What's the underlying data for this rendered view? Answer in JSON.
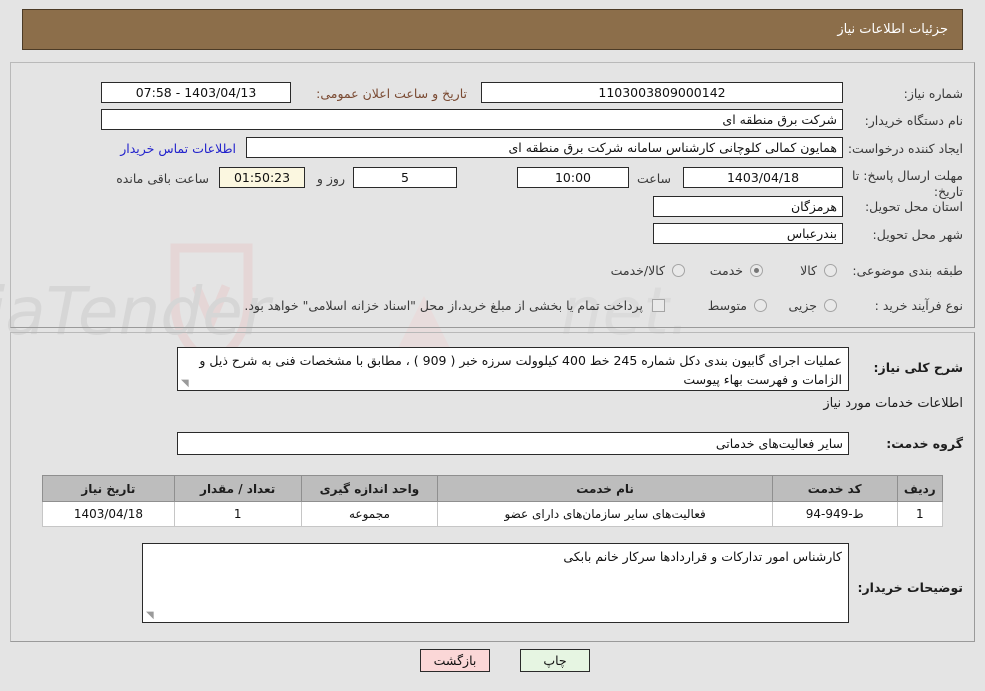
{
  "header": {
    "title": "جزئیات اطلاعات نیاز"
  },
  "top": {
    "need_number_label": "شماره نیاز:",
    "need_number_value": "1103003809000142",
    "public_announce_label": "تاریخ و ساعت اعلان عمومی:",
    "public_announce_value": "1403/04/13 - 07:58",
    "buyer_org_label": "نام دستگاه خریدار:",
    "buyer_org_value": "شرکت برق منطقه ای",
    "creator_label": "ایجاد کننده درخواست:",
    "creator_value": "همایون کمالی کلوچانی کارشناس سامانه شرکت برق منطقه ای",
    "contact_link": "اطلاعات تماس خریدار",
    "deadline_label": "مهلت ارسال پاسخ: تا تاریخ:",
    "deadline_date": "1403/04/18",
    "hour_label": "ساعت",
    "deadline_time": "10:00",
    "days_value": "5",
    "days_label": "روز و",
    "countdown_value": "01:50:23",
    "countdown_label": "ساعت باقی مانده",
    "province_label": "استان محل تحویل:",
    "province_value": "هرمزگان",
    "city_label": "شهر محل تحویل:",
    "city_value": "بندرعباس",
    "classification_label": "طبقه بندی موضوعی:",
    "classification_options": [
      {
        "label": "کالا",
        "selected": false
      },
      {
        "label": "خدمت",
        "selected": true
      },
      {
        "label": "کالا/خدمت",
        "selected": false
      }
    ],
    "process_label": "نوع فرآیند خرید :",
    "process_options": [
      {
        "label": "جزیی",
        "selected": false
      },
      {
        "label": "متوسط",
        "selected": false
      }
    ],
    "treasury_note": "پرداخت تمام یا بخشی از مبلغ خرید،از محل \"اسناد خزانه اسلامی\" خواهد بود."
  },
  "bottom": {
    "desc_label": "شرح کلی نیاز:",
    "desc_value": "عملیات اجرای گابیون بندی دکل شماره 245 خط 400 کیلوولت سرزه خبر ( 909 ) ، مطابق با مشخصات فنی به شرح ذیل و الزامات و فهرست بهاء پیوست",
    "services_heading": "اطلاعات خدمات مورد نیاز",
    "service_group_label": "گروه خدمت:",
    "service_group_value": "سایر فعالیت‌های خدماتی",
    "table": {
      "columns": [
        "ردیف",
        "کد خدمت",
        "نام خدمت",
        "واحد اندازه گیری",
        "تعداد / مقدار",
        "تاریخ نیاز"
      ],
      "rows": [
        {
          "row": "1",
          "code": "ط-949-94",
          "name": "فعالیت‌های سایر سازمان‌های دارای عضو",
          "unit": "مجموعه",
          "qty": "1",
          "date": "1403/04/18"
        }
      ]
    },
    "notes_label": "توضیحات خریدار:",
    "notes_value": "کارشناس امور تدارکات و قراردادها سرکار خانم بابکی"
  },
  "footer": {
    "print_label": "چاپ",
    "back_label": "بازگشت"
  },
  "watermark": {
    "text": "AriaTender.net"
  },
  "colors": {
    "header_bg": "#8c6e4a",
    "accent_label": "#7a4a32",
    "link": "#2222cc",
    "print_btn": "#e6f5e2",
    "back_btn": "#fbd7d7",
    "countdown_bg": "#fbf7e0"
  }
}
